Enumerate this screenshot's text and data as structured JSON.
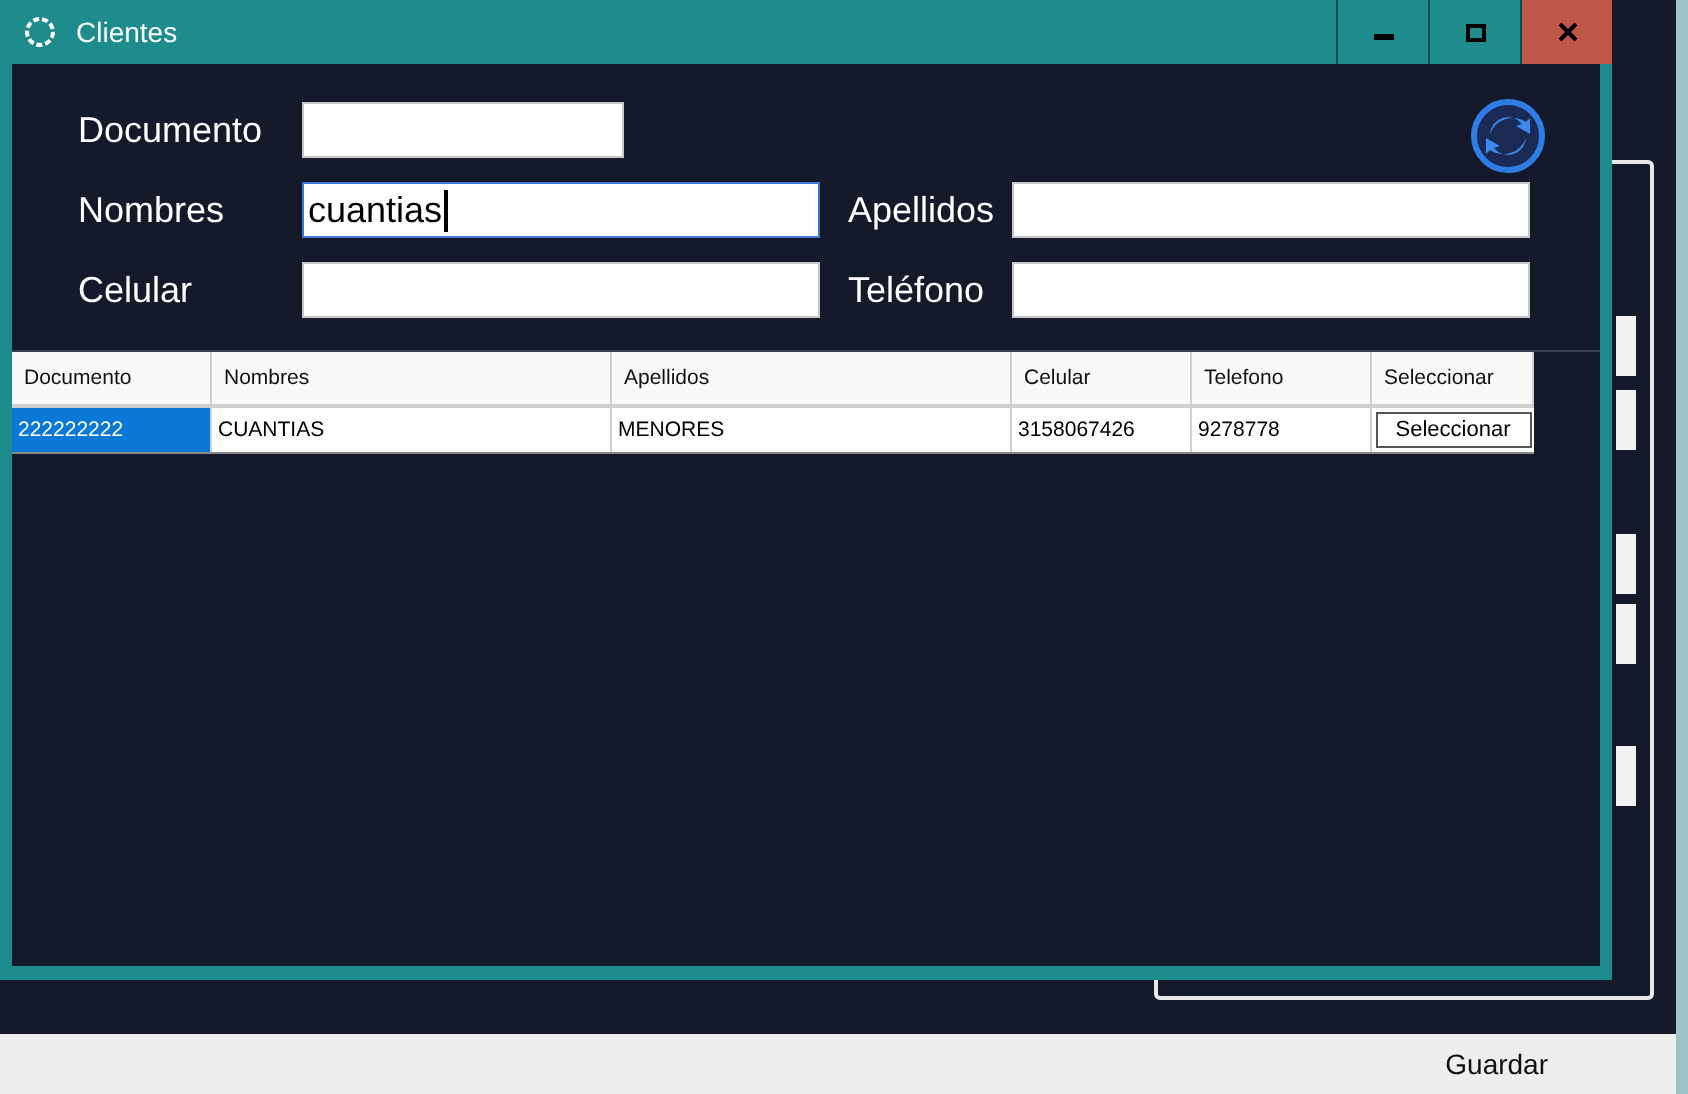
{
  "background_window": {
    "save_button": "Guardar"
  },
  "window": {
    "title": "Clientes"
  },
  "form": {
    "fields": [
      {
        "label": "Documento",
        "focused": false
      },
      {
        "label": "Nombres",
        "value": "cuantias",
        "focused": true
      },
      {
        "label": "Apellidos",
        "focused": false
      },
      {
        "label": "Celular",
        "focused": false
      },
      {
        "label": "Teléfono",
        "focused": false
      }
    ]
  },
  "table": {
    "columns": [
      "Documento",
      "Nombres",
      "Apellidos",
      "Celular",
      "Telefono",
      "Seleccionar"
    ],
    "rows": [
      {
        "cells": [
          "222222222",
          "CUANTIAS",
          "MENORES",
          "3158067426",
          "9278778"
        ],
        "button": "Seleccionar",
        "selected": true
      }
    ]
  }
}
